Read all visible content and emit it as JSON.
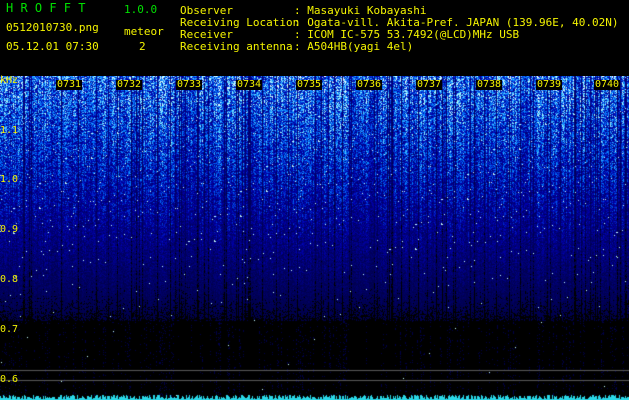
{
  "app": {
    "name": "H R O F F T",
    "version": "1.0.0"
  },
  "file": {
    "name": "0512010730.png",
    "datetime": "05.12.01 07:30"
  },
  "meteor": {
    "label": "meteor",
    "count": "2"
  },
  "info": [
    {
      "key": "Observer",
      "value": ": Masayuki Kobayashi"
    },
    {
      "key": "Receiving Location",
      "value": ": Ogata-vill. Akita-Pref. JAPAN (139.96E, 40.02N)"
    },
    {
      "key": "Receiver",
      "value": ": ICOM IC-575 53.7492(@LCD)MHz USB"
    },
    {
      "key": "Receiving antenna",
      "value": ": A504HB(yagi 4el)"
    }
  ],
  "spectrogram": {
    "unit": "kHz",
    "freq_labels": [
      "1.1",
      "1.0",
      "0.9",
      "0.8",
      "0.7",
      "0.6"
    ],
    "time_labels": [
      "0731",
      "0732",
      "0733",
      "0734",
      "0735",
      "0736",
      "0737",
      "0738",
      "0739",
      "0740"
    ],
    "colors": {
      "background": "#000000",
      "signal_low": "#000064",
      "signal_mid": "#1e3cff",
      "signal_high": "#c8ffff",
      "label": "#f4f400"
    }
  }
}
